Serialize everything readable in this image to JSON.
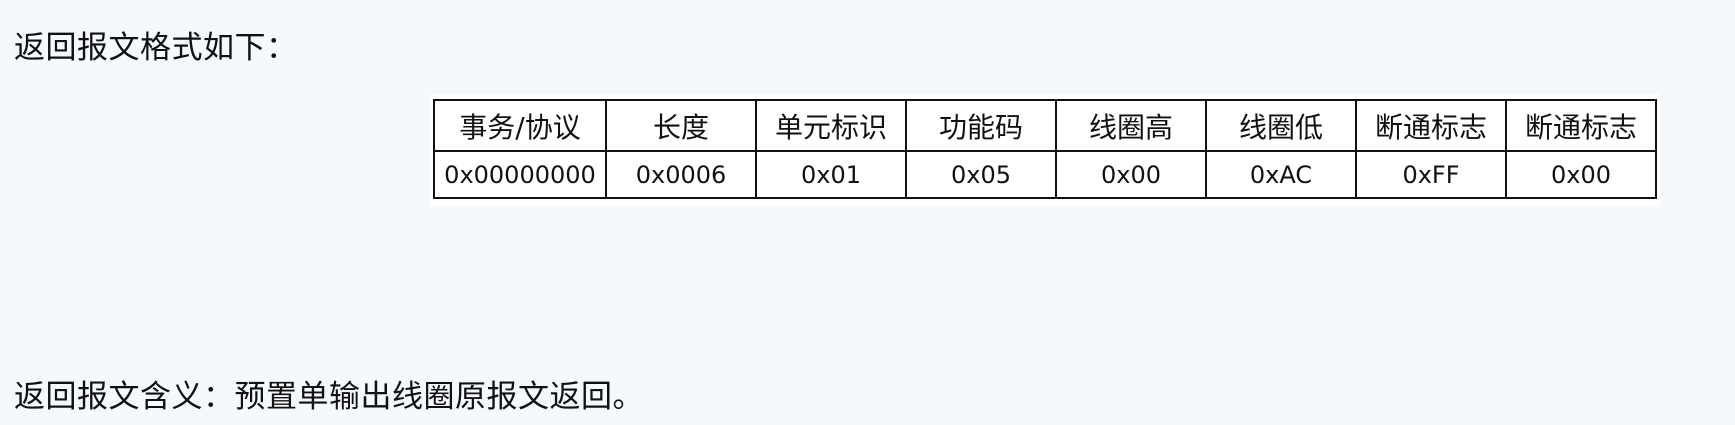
{
  "intro_text": "返回报文格式如下：",
  "table": {
    "headers": [
      "事务/协议",
      "长度",
      "单元标识",
      "功能码",
      "线圈高",
      "线圈低",
      "断通标志",
      "断通标志"
    ],
    "rows": [
      [
        "0x00000000",
        "0x0006",
        "0x01",
        "0x05",
        "0x00",
        "0xAC",
        "0xFF",
        "0x00"
      ]
    ]
  },
  "meaning_text": "返回报文含义：预置单输出线圈原报文返回。"
}
